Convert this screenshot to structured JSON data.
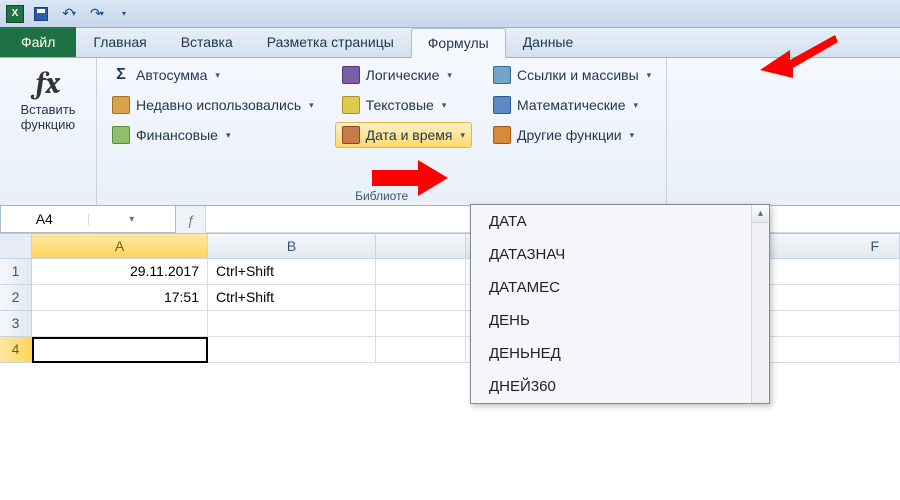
{
  "qat": {
    "app": "X"
  },
  "tabs": {
    "file": "Файл",
    "items": [
      "Главная",
      "Вставка",
      "Разметка страницы",
      "Формулы",
      "Данные"
    ],
    "active": 3
  },
  "ribbon": {
    "insert_fn_line1": "Вставить",
    "insert_fn_line2": "функцию",
    "library_label": "Библиоте",
    "col1": {
      "autosum": "Автосумма",
      "recent": "Недавно использовались",
      "financial": "Финансовые"
    },
    "col2": {
      "logical": "Логические",
      "text": "Текстовые",
      "datetime": "Дата и время"
    },
    "col3": {
      "lookup": "Ссылки и массивы",
      "math": "Математические",
      "more": "Другие функции"
    }
  },
  "namebox": "A4",
  "columns": [
    "A",
    "B",
    "",
    "F"
  ],
  "rows": [
    {
      "n": "1",
      "a": "29.11.2017",
      "b": "Ctrl+Shift"
    },
    {
      "n": "2",
      "a": "17:51",
      "b": "Ctrl+Shift"
    },
    {
      "n": "3",
      "a": "",
      "b": ""
    },
    {
      "n": "4",
      "a": "",
      "b": ""
    }
  ],
  "dropdown": {
    "items": [
      "ДАТА",
      "ДАТАЗНАЧ",
      "ДАТАМЕС",
      "ДЕНЬ",
      "ДЕНЬНЕД",
      "ДНЕЙ360"
    ]
  }
}
